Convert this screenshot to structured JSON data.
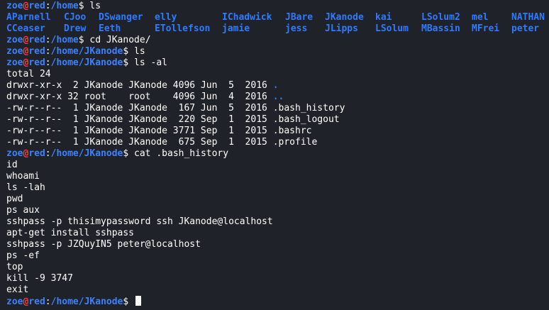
{
  "prompt_parts": {
    "user": "zoe",
    "at": "@",
    "host": "red",
    "colon": ":",
    "dollar": "$ "
  },
  "lines": [
    {
      "type": "prompt",
      "path": "/home",
      "cmd": "ls"
    },
    {
      "type": "ls_row",
      "items": [
        "AParnell",
        "CJoo",
        "DSwanger",
        "elly",
        "IChadwick",
        "JBare",
        "JKanode",
        "kai",
        "LSolum2",
        "mel",
        "NATHAN"
      ]
    },
    {
      "type": "ls_row",
      "items": [
        "CCeaser",
        "Drew",
        "Eeth",
        "ETollefson",
        "jamie",
        "jess",
        "JLipps",
        "LSolum",
        "MBassin",
        "MFrei",
        "peter"
      ]
    },
    {
      "type": "prompt",
      "path": "/home",
      "cmd": "cd JKanode/"
    },
    {
      "type": "prompt",
      "path": "/home/JKanode",
      "cmd": "ls"
    },
    {
      "type": "prompt",
      "path": "/home/JKanode",
      "cmd": "ls -al"
    },
    {
      "type": "text",
      "text": "total 24"
    },
    {
      "type": "lsal",
      "text": "drwxr-xr-x  2 JKanode JKanode 4096 Jun  5  2016 ",
      "name": ".",
      "dir": true
    },
    {
      "type": "lsal",
      "text": "drwxr-xr-x 32 root    root    4096 Jun  4  2016 ",
      "name": "..",
      "dir": true
    },
    {
      "type": "lsal",
      "text": "-rw-r--r--  1 JKanode JKanode  167 Jun  5  2016 ",
      "name": ".bash_history",
      "dir": false
    },
    {
      "type": "lsal",
      "text": "-rw-r--r--  1 JKanode JKanode  220 Sep  1  2015 ",
      "name": ".bash_logout",
      "dir": false
    },
    {
      "type": "lsal",
      "text": "-rw-r--r--  1 JKanode JKanode 3771 Sep  1  2015 ",
      "name": ".bashrc",
      "dir": false
    },
    {
      "type": "lsal",
      "text": "-rw-r--r--  1 JKanode JKanode  675 Sep  1  2015 ",
      "name": ".profile",
      "dir": false
    },
    {
      "type": "prompt",
      "path": "/home/JKanode",
      "cmd": "cat .bash_history"
    },
    {
      "type": "text",
      "text": "id"
    },
    {
      "type": "text",
      "text": "whoami"
    },
    {
      "type": "text",
      "text": "ls -lah"
    },
    {
      "type": "text",
      "text": "pwd"
    },
    {
      "type": "text",
      "text": "ps aux"
    },
    {
      "type": "text",
      "text": "sshpass -p thisimypassword ssh JKanode@localhost"
    },
    {
      "type": "text",
      "text": "apt-get install sshpass"
    },
    {
      "type": "text",
      "text": "sshpass -p JZQuyIN5 peter@localhost"
    },
    {
      "type": "text",
      "text": "ps -ef"
    },
    {
      "type": "text",
      "text": "top"
    },
    {
      "type": "text",
      "text": "kill -9 3747"
    },
    {
      "type": "text",
      "text": "exit"
    },
    {
      "type": "prompt",
      "path": "/home/JKanode",
      "cmd": "",
      "cursor": true
    }
  ],
  "colors": {
    "background": "#1f2229",
    "text": "#ffffff",
    "prompt_blue": "#3b82ff",
    "prompt_red": "#ff3b3b",
    "directory_blue": "#2f7bff"
  }
}
